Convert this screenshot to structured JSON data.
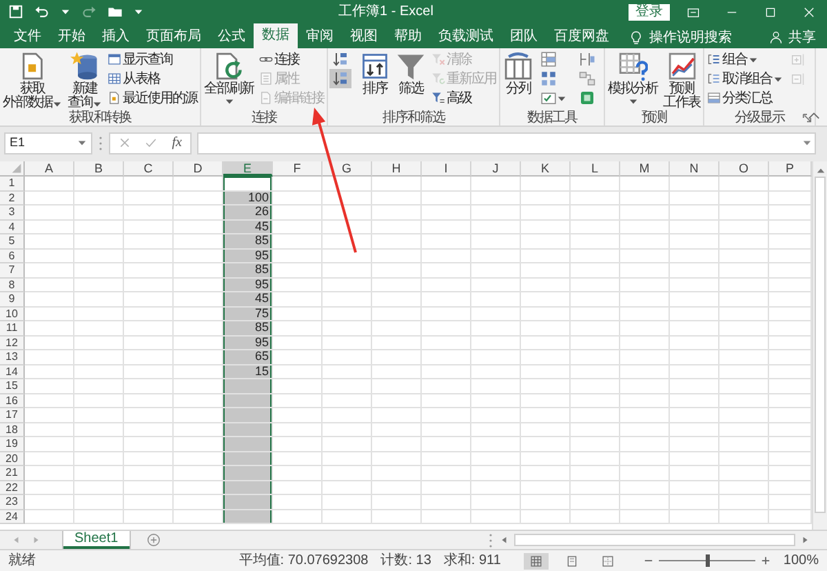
{
  "window": {
    "title": "工作簿1 - Excel"
  },
  "title_bar": {
    "login_button": "登录"
  },
  "tabs": [
    {
      "label": "文件",
      "selected": false
    },
    {
      "label": "开始",
      "selected": false
    },
    {
      "label": "插入",
      "selected": false
    },
    {
      "label": "页面布局",
      "selected": false
    },
    {
      "label": "公式",
      "selected": false
    },
    {
      "label": "数据",
      "selected": true
    },
    {
      "label": "审阅",
      "selected": false
    },
    {
      "label": "视图",
      "selected": false
    },
    {
      "label": "帮助",
      "selected": false
    },
    {
      "label": "负载测试",
      "selected": false
    },
    {
      "label": "团队",
      "selected": false
    },
    {
      "label": "百度网盘",
      "selected": false
    }
  ],
  "tell_me": "操作说明搜索",
  "share": "共享",
  "ribbon_groups": [
    {
      "label": "获取和转换",
      "items": [
        {
          "kind": "large",
          "lines": [
            "获取",
            "外部数据"
          ],
          "dropdown": true
        },
        {
          "kind": "large",
          "lines": [
            "新建",
            "查询"
          ],
          "dropdown": true
        },
        {
          "kind": "stack",
          "items": [
            {
              "label": "显示查询",
              "disabled": false
            },
            {
              "label": "从表格",
              "disabled": false
            },
            {
              "label": "最近使用的源",
              "disabled": false
            }
          ]
        }
      ]
    },
    {
      "label": "连接",
      "items": [
        {
          "kind": "large",
          "lines": [
            "全部刷新"
          ],
          "dropdown": true
        },
        {
          "kind": "stack",
          "items": [
            {
              "label": "连接",
              "disabled": false
            },
            {
              "label": "属性",
              "disabled": true
            },
            {
              "label": "编辑链接",
              "disabled": true
            }
          ]
        }
      ]
    },
    {
      "label": "排序和筛选",
      "items": [
        {
          "kind": "icons",
          "items": [
            {
              "highlighted": false
            },
            {
              "highlighted": true
            }
          ]
        },
        {
          "kind": "large",
          "lines": [
            "排序"
          ]
        },
        {
          "kind": "large",
          "lines": [
            "筛选"
          ]
        },
        {
          "kind": "stack",
          "items": [
            {
              "label": "清除",
              "disabled": true
            },
            {
              "label": "重新应用",
              "disabled": true
            },
            {
              "label": "高级",
              "disabled": false
            }
          ]
        }
      ]
    },
    {
      "label": "数据工具",
      "items": [
        {
          "kind": "large",
          "lines": [
            "分列"
          ]
        },
        {
          "kind": "icons",
          "items": [
            {
              "highlighted": false
            },
            {
              "highlighted": false
            },
            {
              "highlighted": false,
              "dropdown": true
            }
          ]
        },
        {
          "kind": "icons",
          "items": [
            {
              "highlighted": false
            },
            {
              "highlighted": false
            },
            {
              "highlighted": false
            }
          ]
        }
      ]
    },
    {
      "label": "预测",
      "items": [
        {
          "kind": "large",
          "lines": [
            "模拟分析"
          ],
          "dropdown": true
        },
        {
          "kind": "large",
          "lines": [
            "预测",
            "工作表"
          ]
        }
      ]
    },
    {
      "label": "分级显示",
      "launcher": true,
      "items": [
        {
          "kind": "stack",
          "items": [
            {
              "label": "组合",
              "disabled": false,
              "dropdown": true
            },
            {
              "label": "取消组合",
              "disabled": false,
              "dropdown": true
            },
            {
              "label": "分类汇总",
              "disabled": false
            }
          ]
        },
        {
          "kind": "icons",
          "items": [
            {
              "highlighted": false,
              "disabled": true
            },
            {
              "highlighted": false,
              "disabled": true
            }
          ]
        }
      ]
    }
  ],
  "formula_bar": {
    "name_box": "E1",
    "function_button": "fx"
  },
  "columns": [
    {
      "label": "A",
      "selected": false
    },
    {
      "label": "B",
      "selected": false
    },
    {
      "label": "C",
      "selected": false
    },
    {
      "label": "D",
      "selected": false
    },
    {
      "label": "E",
      "selected": true
    },
    {
      "label": "F",
      "selected": false
    },
    {
      "label": "G",
      "selected": false
    },
    {
      "label": "H",
      "selected": false
    },
    {
      "label": "I",
      "selected": false
    },
    {
      "label": "J",
      "selected": false
    },
    {
      "label": "K",
      "selected": false
    },
    {
      "label": "L",
      "selected": false
    },
    {
      "label": "M",
      "selected": false
    },
    {
      "label": "N",
      "selected": false
    },
    {
      "label": "O",
      "selected": false
    },
    {
      "label": "P",
      "selected": false
    }
  ],
  "rows": [
    {
      "number": "1"
    },
    {
      "number": "2",
      "column_E": "100"
    },
    {
      "number": "3",
      "column_E": "26"
    },
    {
      "number": "4",
      "column_E": "45"
    },
    {
      "number": "5",
      "column_E": "85"
    },
    {
      "number": "6",
      "column_E": "95"
    },
    {
      "number": "7",
      "column_E": "85"
    },
    {
      "number": "8",
      "column_E": "95"
    },
    {
      "number": "9",
      "column_E": "45"
    },
    {
      "number": "10",
      "column_E": "75"
    },
    {
      "number": "11",
      "column_E": "85"
    },
    {
      "number": "12",
      "column_E": "95"
    },
    {
      "number": "13",
      "column_E": "65"
    },
    {
      "number": "14",
      "column_E": "15"
    },
    {
      "number": "15"
    },
    {
      "number": "16"
    },
    {
      "number": "17"
    },
    {
      "number": "18"
    },
    {
      "number": "19"
    },
    {
      "number": "20"
    },
    {
      "number": "21"
    },
    {
      "number": "22"
    },
    {
      "number": "23"
    },
    {
      "number": "24"
    }
  ],
  "sheets": [
    {
      "label": "Sheet1",
      "selected": true
    }
  ],
  "status_bar": {
    "ready": "就绪",
    "average": "平均值: 70.07692308",
    "count": "计数: 13",
    "sum": "求和: 911",
    "views": [
      {
        "selected": true
      },
      {
        "selected": false
      },
      {
        "selected": false
      }
    ],
    "zoom": {
      "level": 0.5,
      "reading": "100%"
    }
  }
}
